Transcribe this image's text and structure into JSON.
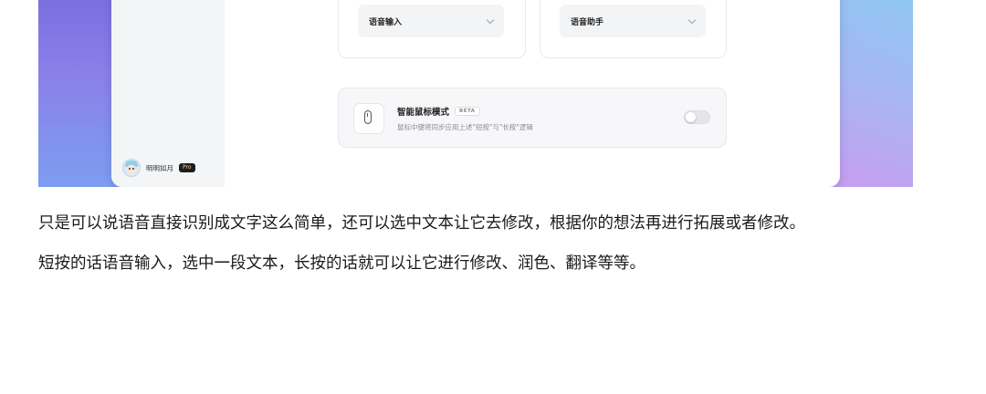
{
  "screenshot": {
    "voice_input_select": {
      "value": "语音输入"
    },
    "voice_assistant_select": {
      "value": "语音助手"
    },
    "mouse_mode": {
      "title": "智能鼠标模式",
      "badge": "BETA",
      "description": "鼠标中键将同步应用上述\"短按\"与\"长按\"逻辑",
      "enabled": false
    },
    "user": {
      "name": "明明如月",
      "badge": "Pro"
    }
  },
  "article": {
    "paragraphs": [
      "只是可以说语音直接识别成文字这么简单，还可以选中文本让它去修改，根据你的想法再进行拓展或者修改。",
      "短按的话语音输入，选中一段文本，长按的话就可以让它进行修改、润色、翻译等等。"
    ]
  }
}
